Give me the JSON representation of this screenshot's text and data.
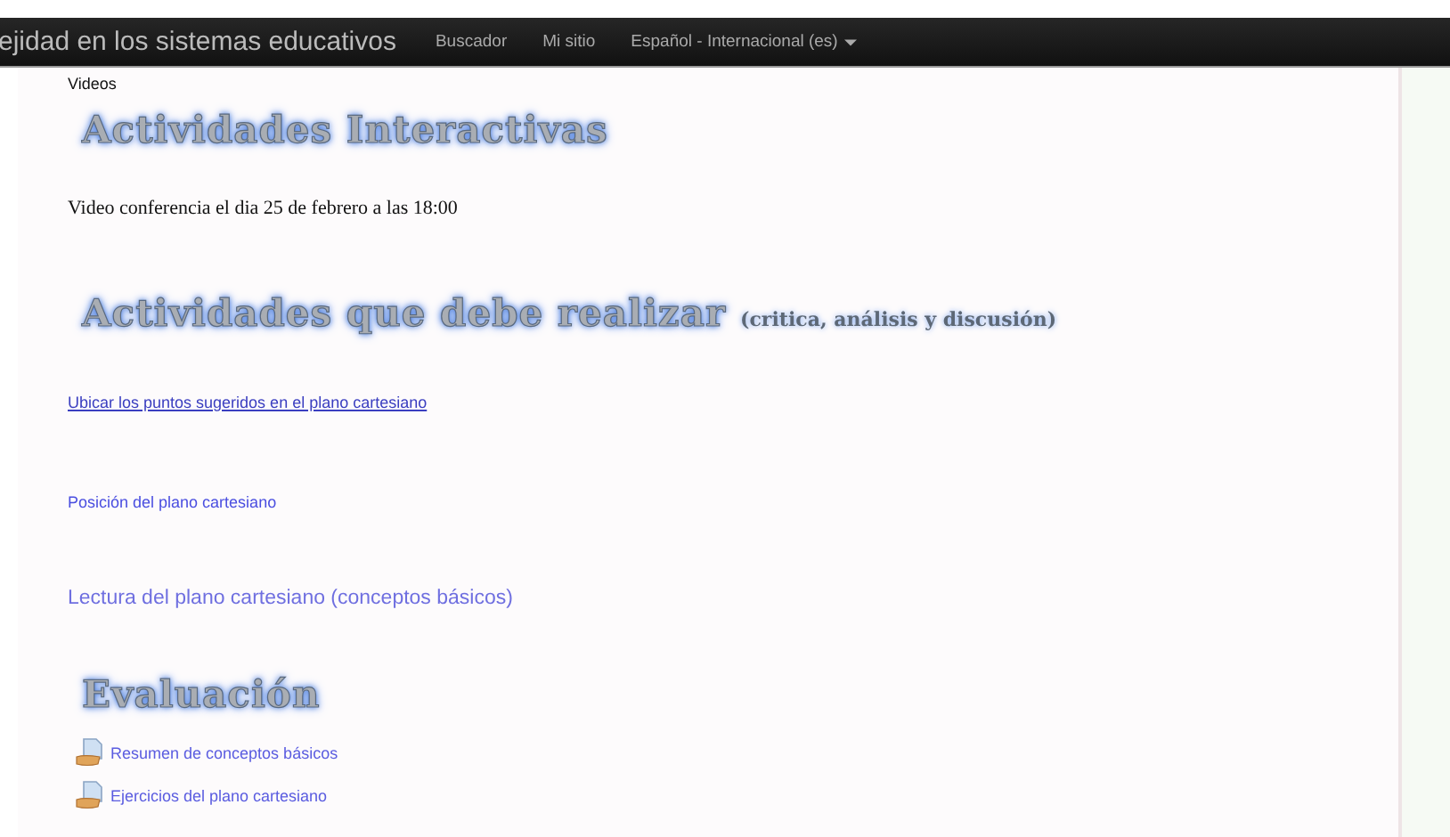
{
  "navbar": {
    "site_name": "ejidad en los sistemas educativos",
    "links": [
      "Buscador",
      "Mi sitio"
    ],
    "language_menu": {
      "label": "Español - Internacional (es)",
      "expanded": false
    }
  },
  "content": [
    {
      "kind": "label",
      "text": "Videos"
    },
    {
      "kind": "heading",
      "text": "Actividades Interactivas"
    },
    {
      "kind": "paragraph",
      "text": "Video conferencia el dia 25 de febrero a las 18:00"
    },
    {
      "kind": "heading",
      "text": "Actividades que debe realizar",
      "subtitle": "(critica, análisis y discusión)"
    },
    {
      "kind": "link",
      "text": "Ubicar los puntos sugeridos en el plano cartesiano",
      "underlined": true
    },
    {
      "kind": "link",
      "text": "Posición del plano cartesiano",
      "underlined": false
    },
    {
      "kind": "biglink",
      "text": "Lectura del plano cartesiano (conceptos básicos)"
    },
    {
      "kind": "heading",
      "text": "Evaluación"
    },
    {
      "kind": "resource",
      "text": "Resumen de conceptos básicos"
    },
    {
      "kind": "resource",
      "text": "Ejercicios del plano cartesiano"
    }
  ]
}
